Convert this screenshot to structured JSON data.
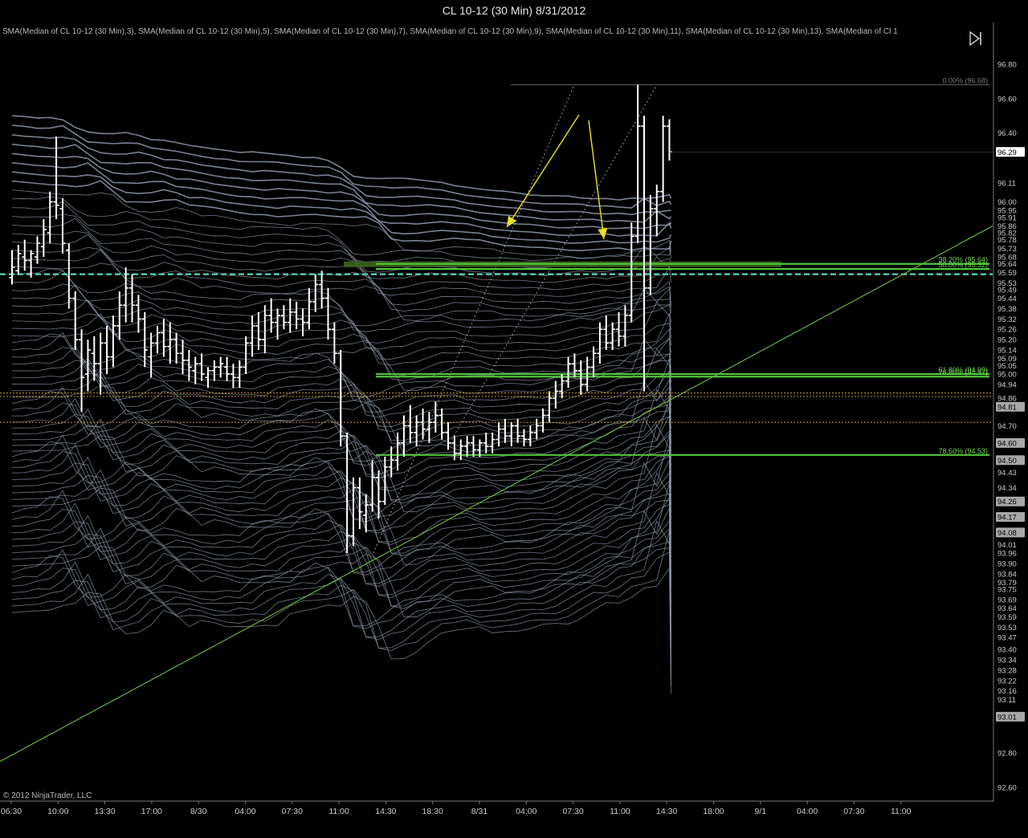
{
  "title": "CL 10-12 (30 Min)  8/31/2012",
  "indicator_legend": "SMA(Median of CL 10-12 (30 Min),3), SMA(Median of CL 10-12 (30 Min),5), SMA(Median of CL 10-12 (30 Min),7), SMA(Median of CL 10-12 (30 Min),9), SMA(Median of CL 10-12 (30 Min),11), SMA(Median of CL 10-12 (30 Min),13), SMA(Median of Cl 1",
  "copyright": "© 2012 NinjaTrader, LLC",
  "colors": {
    "background": "#000000",
    "bars": "#ffffff",
    "sma_lines": "#8e98aa",
    "fib_green": "#4fc43a",
    "trendline": "#6fbf3a",
    "arrows": "#f0e020",
    "dotted_orange": "#c89a30",
    "dashed_cyan": "#58d8c8",
    "axis_text": "#cccccc"
  },
  "icons": {
    "nav": "skip-forward-icon"
  },
  "chart_data": {
    "type": "ohlc",
    "x_tick_labels": [
      "06:30",
      "10:00",
      "13:30",
      "17:00",
      "8/30",
      "04:00",
      "07:30",
      "11:00",
      "14:30",
      "18:30",
      "8/31",
      "04:00",
      "07:30",
      "11:00",
      "14:30",
      "18:00",
      "9/1",
      "04:00",
      "07:30",
      "11:00"
    ],
    "y_tick_labels": [
      "96.80",
      "96.60",
      "96.40",
      "92.80",
      "92.60"
    ],
    "y_range": [
      92.52,
      96.93
    ],
    "current_price": "96.29",
    "price_labels": [
      "96.11",
      "96.00",
      "95.95",
      "95.91",
      "95.86",
      "95.82",
      "95.78",
      "95.73",
      "95.68",
      "95.64",
      "95.59",
      "95.53",
      "95.49",
      "95.44",
      "95.38",
      "95.32",
      "95.26",
      "95.20",
      "95.14",
      "95.09",
      "95.05",
      "95.00",
      "94.94",
      "94.86",
      "94.81",
      "94.70",
      "94.60",
      "94.50",
      "94.43",
      "94.34",
      "94.26",
      "94.17",
      "94.08",
      "94.01",
      "93.96",
      "93.90",
      "93.84",
      "93.79",
      "93.75",
      "93.69",
      "93.64",
      "93.59",
      "93.53",
      "93.47",
      "93.40",
      "93.34",
      "93.28",
      "93.22",
      "93.16",
      "93.11",
      "93.01"
    ],
    "highlighted_labels": [
      "96.29",
      "94.81",
      "94.60",
      "94.50",
      "94.26",
      "94.17",
      "94.08",
      "93.01"
    ],
    "fib_levels": [
      {
        "label": "0.00% (96.68)",
        "price": 96.68
      },
      {
        "label": "38.20% (95.64)",
        "price": 95.64
      },
      {
        "label": "50.00% (95.32)",
        "price": 95.61
      },
      {
        "label": "61.80% (94.99)",
        "price": 95.0
      },
      {
        "label": "76.80% (94.97)",
        "price": 94.985
      },
      {
        "label": "78.60% (94.53)",
        "price": 94.53
      }
    ],
    "horizontal_lines": [
      {
        "style": "dotted",
        "price": 94.89
      },
      {
        "style": "dotted",
        "price": 94.87
      },
      {
        "style": "dotted",
        "price": 94.72
      },
      {
        "style": "dashed",
        "price": 95.58
      }
    ],
    "bars": [
      [
        95.56,
        95.72,
        95.52,
        95.62
      ],
      [
        95.6,
        95.75,
        95.58,
        95.7
      ],
      [
        95.68,
        95.78,
        95.6,
        95.66
      ],
      [
        95.66,
        95.72,
        95.56,
        95.7
      ],
      [
        95.68,
        95.8,
        95.64,
        95.76
      ],
      [
        95.74,
        95.9,
        95.68,
        95.84
      ],
      [
        95.82,
        96.06,
        95.76,
        96.0
      ],
      [
        96.0,
        96.38,
        95.9,
        95.98
      ],
      [
        95.96,
        96.02,
        95.7,
        95.76
      ],
      [
        95.72,
        95.76,
        95.38,
        95.44
      ],
      [
        95.44,
        95.48,
        95.14,
        95.2
      ],
      [
        95.2,
        95.26,
        94.78,
        94.98
      ],
      [
        95.0,
        95.2,
        94.9,
        95.14
      ],
      [
        95.12,
        95.22,
        94.96,
        95.06
      ],
      [
        95.06,
        95.24,
        94.88,
        95.18
      ],
      [
        95.18,
        95.28,
        95.0,
        95.1
      ],
      [
        95.1,
        95.34,
        95.04,
        95.28
      ],
      [
        95.28,
        95.48,
        95.2,
        95.4
      ],
      [
        95.4,
        95.62,
        95.3,
        95.5
      ],
      [
        95.5,
        95.58,
        95.3,
        95.4
      ],
      [
        95.4,
        95.46,
        95.24,
        95.32
      ],
      [
        95.32,
        95.36,
        95.04,
        95.14
      ],
      [
        95.1,
        95.24,
        94.98,
        95.18
      ],
      [
        95.18,
        95.28,
        95.12,
        95.24
      ],
      [
        95.24,
        95.32,
        95.1,
        95.16
      ],
      [
        95.16,
        95.3,
        95.06,
        95.2
      ],
      [
        95.2,
        95.24,
        95.06,
        95.12
      ],
      [
        95.12,
        95.2,
        95.0,
        95.08
      ],
      [
        95.08,
        95.14,
        94.96,
        95.04
      ],
      [
        95.02,
        95.1,
        94.94,
        95.06
      ],
      [
        95.06,
        95.12,
        94.96,
        95.0
      ],
      [
        94.98,
        95.04,
        94.92,
        95.02
      ],
      [
        95.02,
        95.08,
        94.96,
        95.04
      ],
      [
        95.04,
        95.1,
        94.98,
        95.06
      ],
      [
        95.04,
        95.1,
        94.96,
        95.0
      ],
      [
        95.0,
        95.06,
        94.92,
        94.98
      ],
      [
        94.98,
        95.08,
        94.92,
        95.04
      ],
      [
        95.04,
        95.22,
        95.0,
        95.18
      ],
      [
        95.18,
        95.34,
        95.1,
        95.28
      ],
      [
        95.28,
        95.36,
        95.14,
        95.2
      ],
      [
        95.2,
        95.4,
        95.12,
        95.34
      ],
      [
        95.34,
        95.44,
        95.24,
        95.3
      ],
      [
        95.3,
        95.38,
        95.2,
        95.34
      ],
      [
        95.34,
        95.4,
        95.26,
        95.3
      ],
      [
        95.3,
        95.44,
        95.24,
        95.36
      ],
      [
        95.36,
        95.42,
        95.26,
        95.32
      ],
      [
        95.32,
        95.38,
        95.22,
        95.3
      ],
      [
        95.3,
        95.5,
        95.26,
        95.42
      ],
      [
        95.42,
        95.58,
        95.36,
        95.52
      ],
      [
        95.52,
        95.6,
        95.38,
        95.44
      ],
      [
        95.44,
        95.5,
        95.2,
        95.26
      ],
      [
        95.26,
        95.3,
        95.06,
        95.12
      ],
      [
        95.12,
        95.14,
        94.58,
        94.64
      ],
      [
        94.64,
        94.66,
        93.96,
        94.06
      ],
      [
        94.06,
        94.4,
        94.0,
        94.34
      ],
      [
        94.34,
        94.4,
        94.1,
        94.2
      ],
      [
        94.18,
        94.3,
        94.08,
        94.24
      ],
      [
        94.24,
        94.5,
        94.2,
        94.4
      ],
      [
        94.4,
        94.44,
        94.16,
        94.26
      ],
      [
        94.26,
        94.52,
        94.24,
        94.46
      ],
      [
        94.46,
        94.58,
        94.4,
        94.5
      ],
      [
        94.5,
        94.66,
        94.44,
        94.6
      ],
      [
        94.6,
        94.76,
        94.52,
        94.7
      ],
      [
        94.7,
        94.82,
        94.6,
        94.66
      ],
      [
        94.66,
        94.76,
        94.58,
        94.72
      ],
      [
        94.72,
        94.8,
        94.62,
        94.68
      ],
      [
        94.68,
        94.78,
        94.6,
        94.72
      ],
      [
        94.72,
        94.84,
        94.66,
        94.76
      ],
      [
        94.76,
        94.8,
        94.62,
        94.66
      ],
      [
        94.66,
        94.72,
        94.56,
        94.6
      ],
      [
        94.6,
        94.64,
        94.5,
        94.54
      ],
      [
        94.54,
        94.62,
        94.5,
        94.58
      ],
      [
        94.58,
        94.64,
        94.52,
        94.6
      ],
      [
        94.6,
        94.64,
        94.52,
        94.56
      ],
      [
        94.56,
        94.62,
        94.52,
        94.6
      ],
      [
        94.6,
        94.66,
        94.54,
        94.58
      ],
      [
        94.58,
        94.66,
        94.54,
        94.62
      ],
      [
        94.62,
        94.72,
        94.58,
        94.68
      ],
      [
        94.68,
        94.74,
        94.6,
        94.64
      ],
      [
        94.64,
        94.72,
        94.58,
        94.7
      ],
      [
        94.7,
        94.74,
        94.6,
        94.64
      ],
      [
        94.64,
        94.68,
        94.58,
        94.62
      ],
      [
        94.62,
        94.7,
        94.58,
        94.66
      ],
      [
        94.66,
        94.74,
        94.62,
        94.7
      ],
      [
        94.7,
        94.8,
        94.66,
        94.76
      ],
      [
        94.76,
        94.9,
        94.72,
        94.86
      ],
      [
        94.86,
        94.96,
        94.8,
        94.9
      ],
      [
        94.9,
        95.0,
        94.86,
        94.96
      ],
      [
        94.96,
        95.1,
        94.92,
        95.06
      ],
      [
        95.06,
        95.12,
        94.98,
        95.02
      ],
      [
        95.02,
        95.08,
        94.88,
        94.94
      ],
      [
        94.94,
        95.1,
        94.9,
        95.04
      ],
      [
        95.04,
        95.16,
        94.98,
        95.12
      ],
      [
        95.12,
        95.3,
        95.06,
        95.26
      ],
      [
        95.26,
        95.34,
        95.14,
        95.18
      ],
      [
        95.18,
        95.3,
        95.14,
        95.26
      ],
      [
        95.26,
        95.36,
        95.16,
        95.22
      ],
      [
        95.22,
        95.4,
        95.16,
        95.34
      ],
      [
        95.34,
        95.88,
        95.3,
        95.8
      ],
      [
        95.8,
        96.68,
        95.76,
        96.44
      ],
      [
        96.44,
        96.5,
        94.9,
        95.5
      ],
      [
        95.5,
        96.04,
        95.46,
        95.96
      ],
      [
        95.96,
        96.1,
        95.8,
        96.06
      ],
      [
        96.06,
        96.5,
        96.0,
        96.44
      ],
      [
        96.44,
        96.48,
        96.24,
        96.29
      ]
    ]
  }
}
